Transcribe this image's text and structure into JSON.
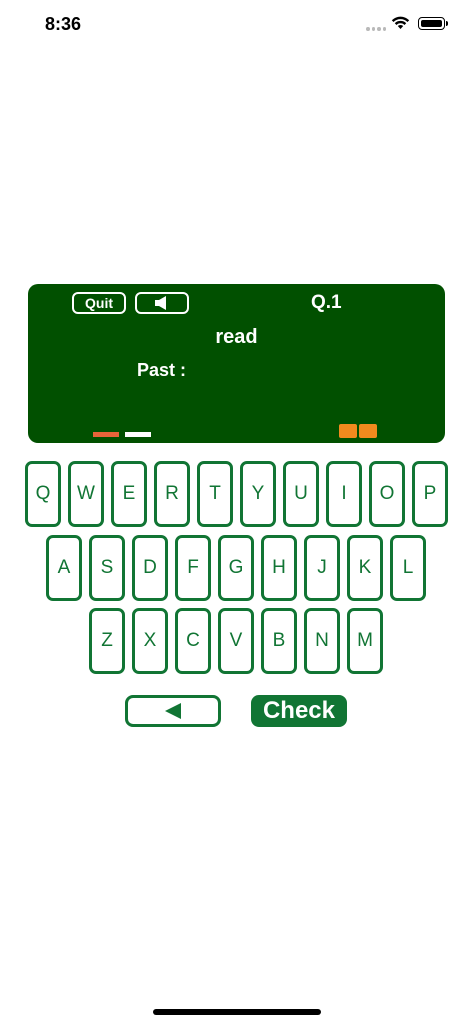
{
  "status_bar": {
    "time": "8:36"
  },
  "board": {
    "quit_label": "Quit",
    "sound_icon": "speaker-icon",
    "question_number": "Q.1",
    "word": "read",
    "prompt_label": "Past :",
    "progress_left_colors": [
      "#e8643a",
      "#ffffff"
    ],
    "progress_right_count": 2,
    "accent_color": "#f28a1e"
  },
  "keyboard": {
    "row1": [
      "Q",
      "W",
      "E",
      "R",
      "T",
      "Y",
      "U",
      "I",
      "O",
      "P"
    ],
    "row2": [
      "A",
      "S",
      "D",
      "F",
      "G",
      "H",
      "J",
      "K",
      "L"
    ],
    "row3": [
      "Z",
      "X",
      "C",
      "V",
      "B",
      "N",
      "M"
    ]
  },
  "actions": {
    "backspace_icon": "left-triangle-icon",
    "check_label": "Check"
  },
  "colors": {
    "board": "#015000",
    "key_border": "#117534"
  }
}
